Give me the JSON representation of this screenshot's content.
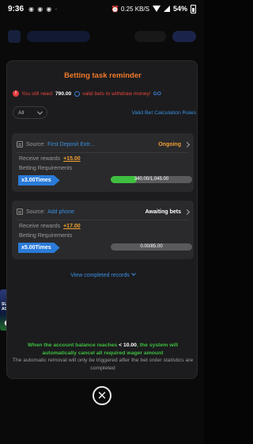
{
  "status_bar": {
    "time": "9:36",
    "left_icons": "◉ ◉ ◉ ·",
    "right_icons": "⏰ 0.25 KB/S",
    "battery": "54%"
  },
  "modal": {
    "title": "Betting task reminder",
    "notice": {
      "prefix": "You still need",
      "amount": "790.00",
      "suffix": "valid bets to withdraw money!",
      "go": "GO"
    },
    "filter": {
      "selected": "All"
    },
    "rules_link": "Valid Bet Calculation Rules",
    "tasks": [
      {
        "source_label": "Source:",
        "source_name": "First Deposit Extr...",
        "status": "Ongoing",
        "receive_label": "Receive rewards",
        "reward": "+15.00",
        "requirements_label": "Betting Requirements",
        "multiplier": "x3.00Times",
        "progress_text": "340.00/1,045.00",
        "progress_fraction": 0.325
      },
      {
        "source_label": "Source:",
        "source_name": "Add phone",
        "status": "Awaiting bets",
        "receive_label": "Receive rewards",
        "reward": "+17.00",
        "requirements_label": "Betting Requirements",
        "multiplier": "x5.00Times",
        "progress_text": "0.00/85.00",
        "progress_fraction": 0
      }
    ],
    "view_completed": "View completed records",
    "footer": {
      "line1_green_a": "When the account balance reaches",
      "line1_white": "< 10.00",
      "line1_green_b": ", the system will automatically cancel all required wager amount",
      "line2": "The automatic removal will only be triggered after the bet order statistics are completed"
    }
  },
  "background": {
    "side_game_label": "SUPER ACE"
  },
  "colors": {
    "accent_orange": "#f07a2a",
    "link_blue": "#3a8fe0",
    "progress_green": "#3fbf3f",
    "warning_red": "#e8453c"
  },
  "icons": [
    "warning-icon",
    "coin-icon",
    "chevron-down-icon",
    "source-icon",
    "chevron-right-icon",
    "close-icon"
  ]
}
